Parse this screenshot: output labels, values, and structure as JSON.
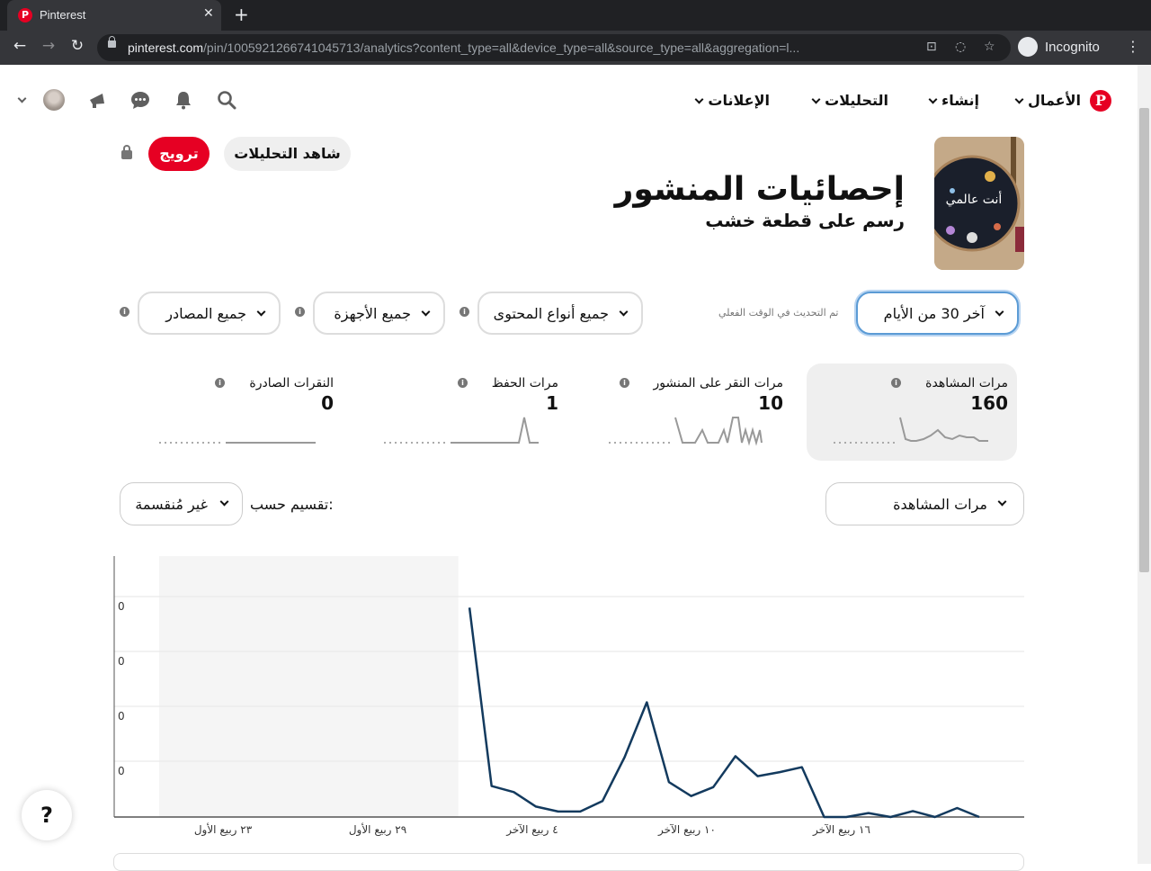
{
  "browser": {
    "tab_title": "Pinterest",
    "url_host": "pinterest.com",
    "url_path": "/pin/1005921266741045713/analytics?content_type=all&device_type=all&source_type=all&aggregation=l...",
    "incognito_label": "Incognito"
  },
  "header": {
    "logo": "P",
    "nav": [
      {
        "label": "الأعمال"
      },
      {
        "label": "إنشاء"
      },
      {
        "label": "التحليلات"
      },
      {
        "label": "الإعلانات"
      }
    ]
  },
  "pin": {
    "title": "إحصائيات المنشور",
    "subtitle": "رسم على قطعة خشب",
    "see_analytics": "شاهد التحليلات",
    "promote": "ترويج",
    "thumb_text": "أنت عالمي"
  },
  "filters": {
    "date_range": "آخر 30 من الأيام",
    "realtime_note": "تم التحديث في الوقت الفعلي",
    "content_type": "جميع أنواع المحتوى",
    "device": "جميع الأجهزة",
    "source": "جميع المصادر"
  },
  "metrics": [
    {
      "label": "مرات المشاهدة",
      "value": "160",
      "active": true
    },
    {
      "label": "مرات النقر على المنشور",
      "value": "10",
      "active": false
    },
    {
      "label": "مرات الحفظ",
      "value": "1",
      "active": false
    },
    {
      "label": "النقرات الصادرة",
      "value": "0",
      "active": false
    }
  ],
  "split": {
    "metric_select": "مرات المشاهدة",
    "split_label": "تقسيم حسب:",
    "split_value": "غير مُنقسمة"
  },
  "help_label": "?",
  "colors": {
    "accent": "#e60023",
    "line": "#133a5e"
  },
  "chart_data": {
    "type": "line",
    "x": [
      "٢٣ ربيع الأول",
      "٢٩ ربيع الأول",
      "٤ ربيع الآخر",
      "١٠ ربيع الآخر",
      "١٦ ربيع الآخر"
    ],
    "ytick_labels": [
      "0",
      "0",
      "0",
      "0"
    ],
    "series": [
      {
        "values": [
          null,
          null,
          null,
          null,
          null,
          null,
          null,
          null,
          null,
          null,
          null,
          null,
          null,
          null,
          42,
          6.2,
          5.0,
          2.1,
          1.1,
          1.1,
          3.2,
          12.0,
          23.0,
          7.0,
          4.2,
          6.0,
          12.2,
          8.2,
          9.0,
          10.0,
          0,
          0,
          0.8,
          0,
          1.2,
          0,
          1.8,
          0
        ]
      }
    ],
    "shaded_region_count": 13,
    "grid": true
  }
}
